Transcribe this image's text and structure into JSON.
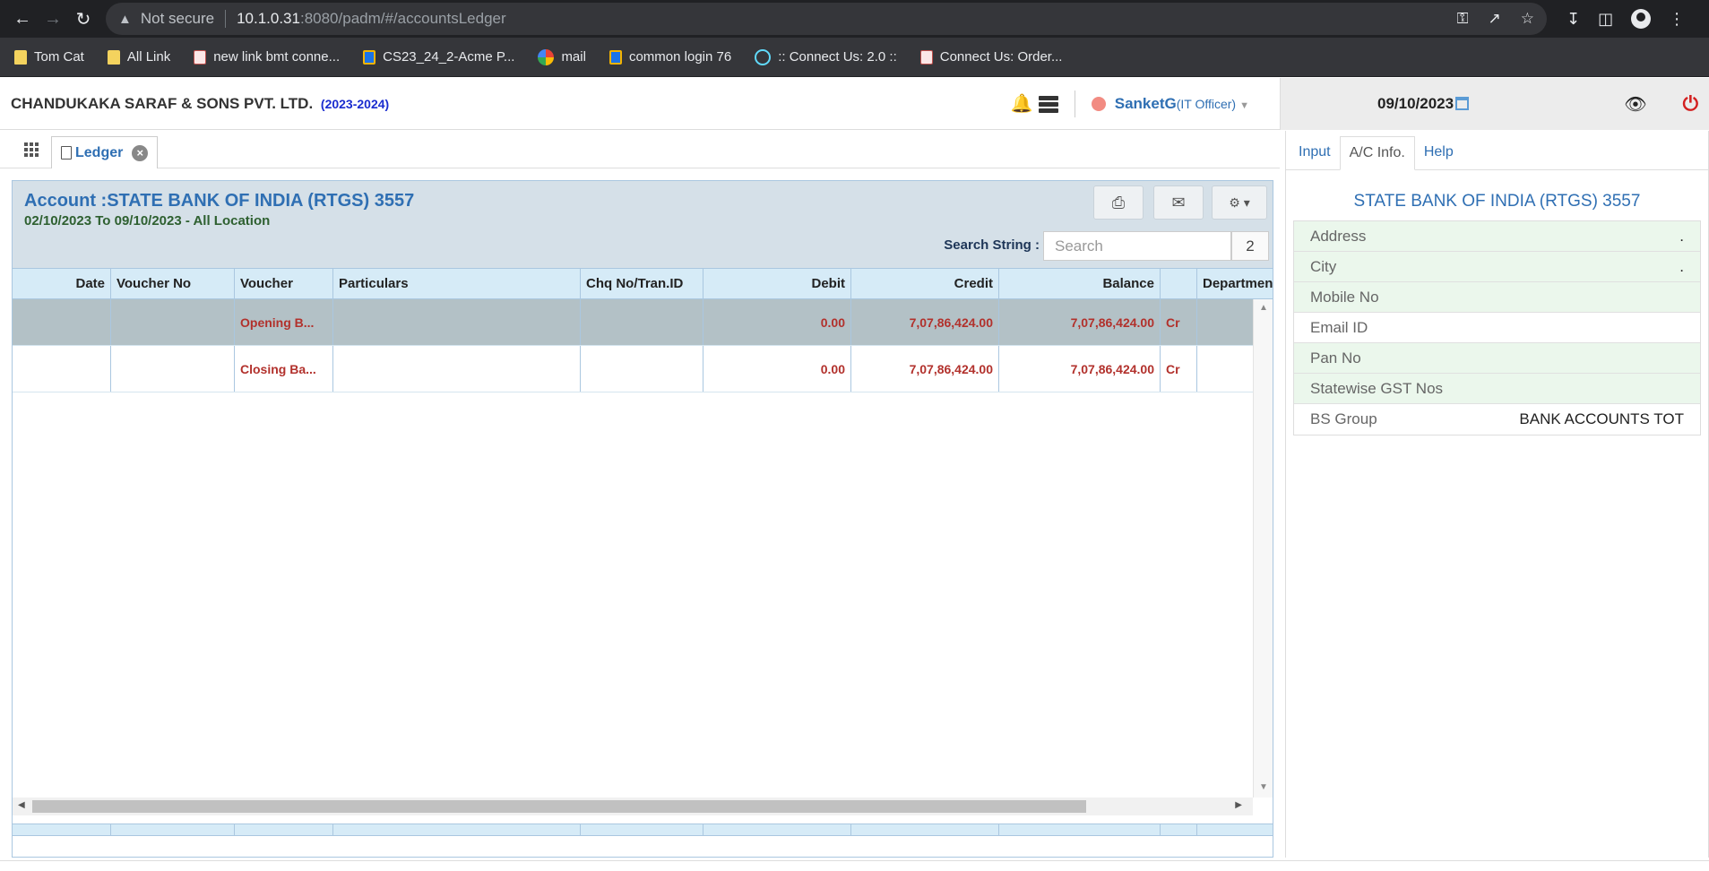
{
  "browser": {
    "security_label": "Not secure",
    "url_host": "10.1.0.31",
    "url_path": ":8080/padm/#/accountsLedger",
    "bookmarks": [
      {
        "label": "Tom Cat",
        "icon": "folder"
      },
      {
        "label": "All Link",
        "icon": "folder"
      },
      {
        "label": "new link bmt conne...",
        "icon": "red"
      },
      {
        "label": "CS23_24_2-Acme P...",
        "icon": "grid"
      },
      {
        "label": "mail",
        "icon": "g"
      },
      {
        "label": "common login 76",
        "icon": "grid"
      },
      {
        "label": ":: Connect Us: 2.0 ::",
        "icon": "react"
      },
      {
        "label": "Connect Us: Order...",
        "icon": "red"
      }
    ]
  },
  "header": {
    "company": "CHANDUKAKA SARAF & SONS PVT. LTD.",
    "year": "(2023-2024)",
    "user": "SanketG",
    "role": "(IT Officer)",
    "date": "09/10/2023"
  },
  "tabs": {
    "ledger_label": "Ledger"
  },
  "ledger": {
    "account_title": "Account :STATE BANK OF INDIA (RTGS) 3557",
    "subtitle": "02/10/2023 To 09/10/2023 - All Location",
    "search_label": "Search String :",
    "search_placeholder": "Search",
    "search_count": "2",
    "columns": {
      "date": "Date",
      "voucher_no": "Voucher No",
      "voucher": "Voucher",
      "particulars": "Particulars",
      "chq": "Chq No/Tran.ID",
      "debit": "Debit",
      "credit": "Credit",
      "balance": "Balance",
      "drcr": "",
      "department": "Departmen"
    },
    "rows": [
      {
        "date": "",
        "voucher_no": "",
        "voucher": "Opening B...",
        "particulars": "",
        "chq": "",
        "debit": "0.00",
        "credit": "7,07,86,424.00",
        "balance": "7,07,86,424.00",
        "drcr": "Cr",
        "department": ""
      },
      {
        "date": "",
        "voucher_no": "",
        "voucher": "Closing Ba...",
        "particulars": "",
        "chq": "",
        "debit": "0.00",
        "credit": "7,07,86,424.00",
        "balance": "7,07,86,424.00",
        "drcr": "Cr",
        "department": ""
      }
    ]
  },
  "info": {
    "tabs": [
      "Input",
      "A/C Info.",
      "Help"
    ],
    "bank_title": "STATE BANK OF INDIA (RTGS) 3557",
    "fields": [
      {
        "label": "Address",
        "value": "."
      },
      {
        "label": "City",
        "value": "."
      },
      {
        "label": "Mobile No",
        "value": ""
      },
      {
        "label": "Email ID",
        "value": ""
      },
      {
        "label": "Pan No",
        "value": ""
      },
      {
        "label": "Statewise GST Nos",
        "value": ""
      },
      {
        "label": "BS Group",
        "value": "BANK ACCOUNTS TOT"
      }
    ]
  }
}
